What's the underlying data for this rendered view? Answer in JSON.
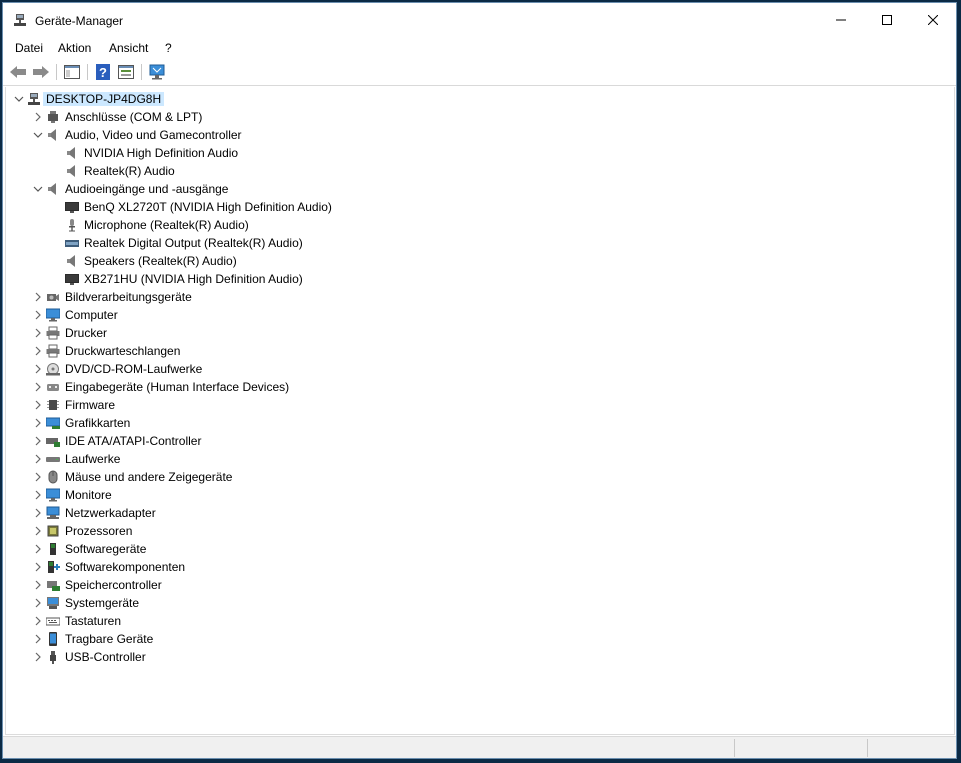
{
  "window": {
    "title": "Geräte-Manager"
  },
  "menu": [
    "Datei",
    "Aktion",
    "Ansicht",
    "?"
  ],
  "toolbar": [
    {
      "name": "back-button",
      "icon": "arrow-left-icon"
    },
    {
      "name": "forward-button",
      "icon": "arrow-right-icon"
    },
    {
      "name": "show-hide-console-tree-button",
      "icon": "console-tree-icon"
    },
    {
      "name": "help-button",
      "icon": "help-icon"
    },
    {
      "name": "properties-button",
      "icon": "properties-icon"
    },
    {
      "name": "scan-hardware-button",
      "icon": "monitor-scan-icon"
    }
  ],
  "tree": [
    {
      "label": "DESKTOP-JP4DG8H",
      "level": 0,
      "state": "expanded",
      "icon": "computer-tower-icon",
      "selected": true
    },
    {
      "label": "Anschlüsse (COM & LPT)",
      "level": 1,
      "state": "collapsed",
      "icon": "port-icon"
    },
    {
      "label": "Audio, Video und Gamecontroller",
      "level": 1,
      "state": "expanded",
      "icon": "speaker-icon"
    },
    {
      "label": "NVIDIA High Definition Audio",
      "level": 2,
      "state": "leaf",
      "icon": "speaker-icon"
    },
    {
      "label": "Realtek(R) Audio",
      "level": 2,
      "state": "leaf",
      "icon": "speaker-icon"
    },
    {
      "label": "Audioeingänge und -ausgänge",
      "level": 1,
      "state": "expanded",
      "icon": "speaker-icon"
    },
    {
      "label": "BenQ XL2720T (NVIDIA High Definition Audio)",
      "level": 2,
      "state": "leaf",
      "icon": "display-icon"
    },
    {
      "label": "Microphone (Realtek(R) Audio)",
      "level": 2,
      "state": "leaf",
      "icon": "microphone-icon"
    },
    {
      "label": "Realtek Digital Output (Realtek(R) Audio)",
      "level": 2,
      "state": "leaf",
      "icon": "digital-output-icon"
    },
    {
      "label": "Speakers (Realtek(R) Audio)",
      "level": 2,
      "state": "leaf",
      "icon": "speaker-icon"
    },
    {
      "label": "XB271HU (NVIDIA High Definition Audio)",
      "level": 2,
      "state": "leaf",
      "icon": "display-icon"
    },
    {
      "label": "Bildverarbeitungsgeräte",
      "level": 1,
      "state": "collapsed",
      "icon": "camera-icon"
    },
    {
      "label": "Computer",
      "level": 1,
      "state": "collapsed",
      "icon": "monitor-icon"
    },
    {
      "label": "Drucker",
      "level": 1,
      "state": "collapsed",
      "icon": "printer-icon"
    },
    {
      "label": "Druckwarteschlangen",
      "level": 1,
      "state": "collapsed",
      "icon": "printer-icon"
    },
    {
      "label": "DVD/CD-ROM-Laufwerke",
      "level": 1,
      "state": "collapsed",
      "icon": "disc-drive-icon"
    },
    {
      "label": "Eingabegeräte (Human Interface Devices)",
      "level": 1,
      "state": "collapsed",
      "icon": "hid-icon"
    },
    {
      "label": "Firmware",
      "level": 1,
      "state": "collapsed",
      "icon": "chip-icon"
    },
    {
      "label": "Grafikkarten",
      "level": 1,
      "state": "collapsed",
      "icon": "graphics-card-icon"
    },
    {
      "label": "IDE ATA/ATAPI-Controller",
      "level": 1,
      "state": "collapsed",
      "icon": "controller-icon"
    },
    {
      "label": "Laufwerke",
      "level": 1,
      "state": "collapsed",
      "icon": "drive-icon"
    },
    {
      "label": "Mäuse und andere Zeigegeräte",
      "level": 1,
      "state": "collapsed",
      "icon": "mouse-icon"
    },
    {
      "label": "Monitore",
      "level": 1,
      "state": "collapsed",
      "icon": "monitor-icon"
    },
    {
      "label": "Netzwerkadapter",
      "level": 1,
      "state": "collapsed",
      "icon": "network-icon"
    },
    {
      "label": "Prozessoren",
      "level": 1,
      "state": "collapsed",
      "icon": "processor-icon"
    },
    {
      "label": "Softwaregeräte",
      "level": 1,
      "state": "collapsed",
      "icon": "software-device-icon"
    },
    {
      "label": "Softwarekomponenten",
      "level": 1,
      "state": "collapsed",
      "icon": "software-component-icon"
    },
    {
      "label": "Speichercontroller",
      "level": 1,
      "state": "collapsed",
      "icon": "storage-controller-icon"
    },
    {
      "label": "Systemgeräte",
      "level": 1,
      "state": "collapsed",
      "icon": "system-device-icon"
    },
    {
      "label": "Tastaturen",
      "level": 1,
      "state": "collapsed",
      "icon": "keyboard-icon"
    },
    {
      "label": "Tragbare Geräte",
      "level": 1,
      "state": "collapsed",
      "icon": "portable-device-icon"
    },
    {
      "label": "USB-Controller",
      "level": 1,
      "state": "collapsed",
      "icon": "usb-icon"
    }
  ]
}
